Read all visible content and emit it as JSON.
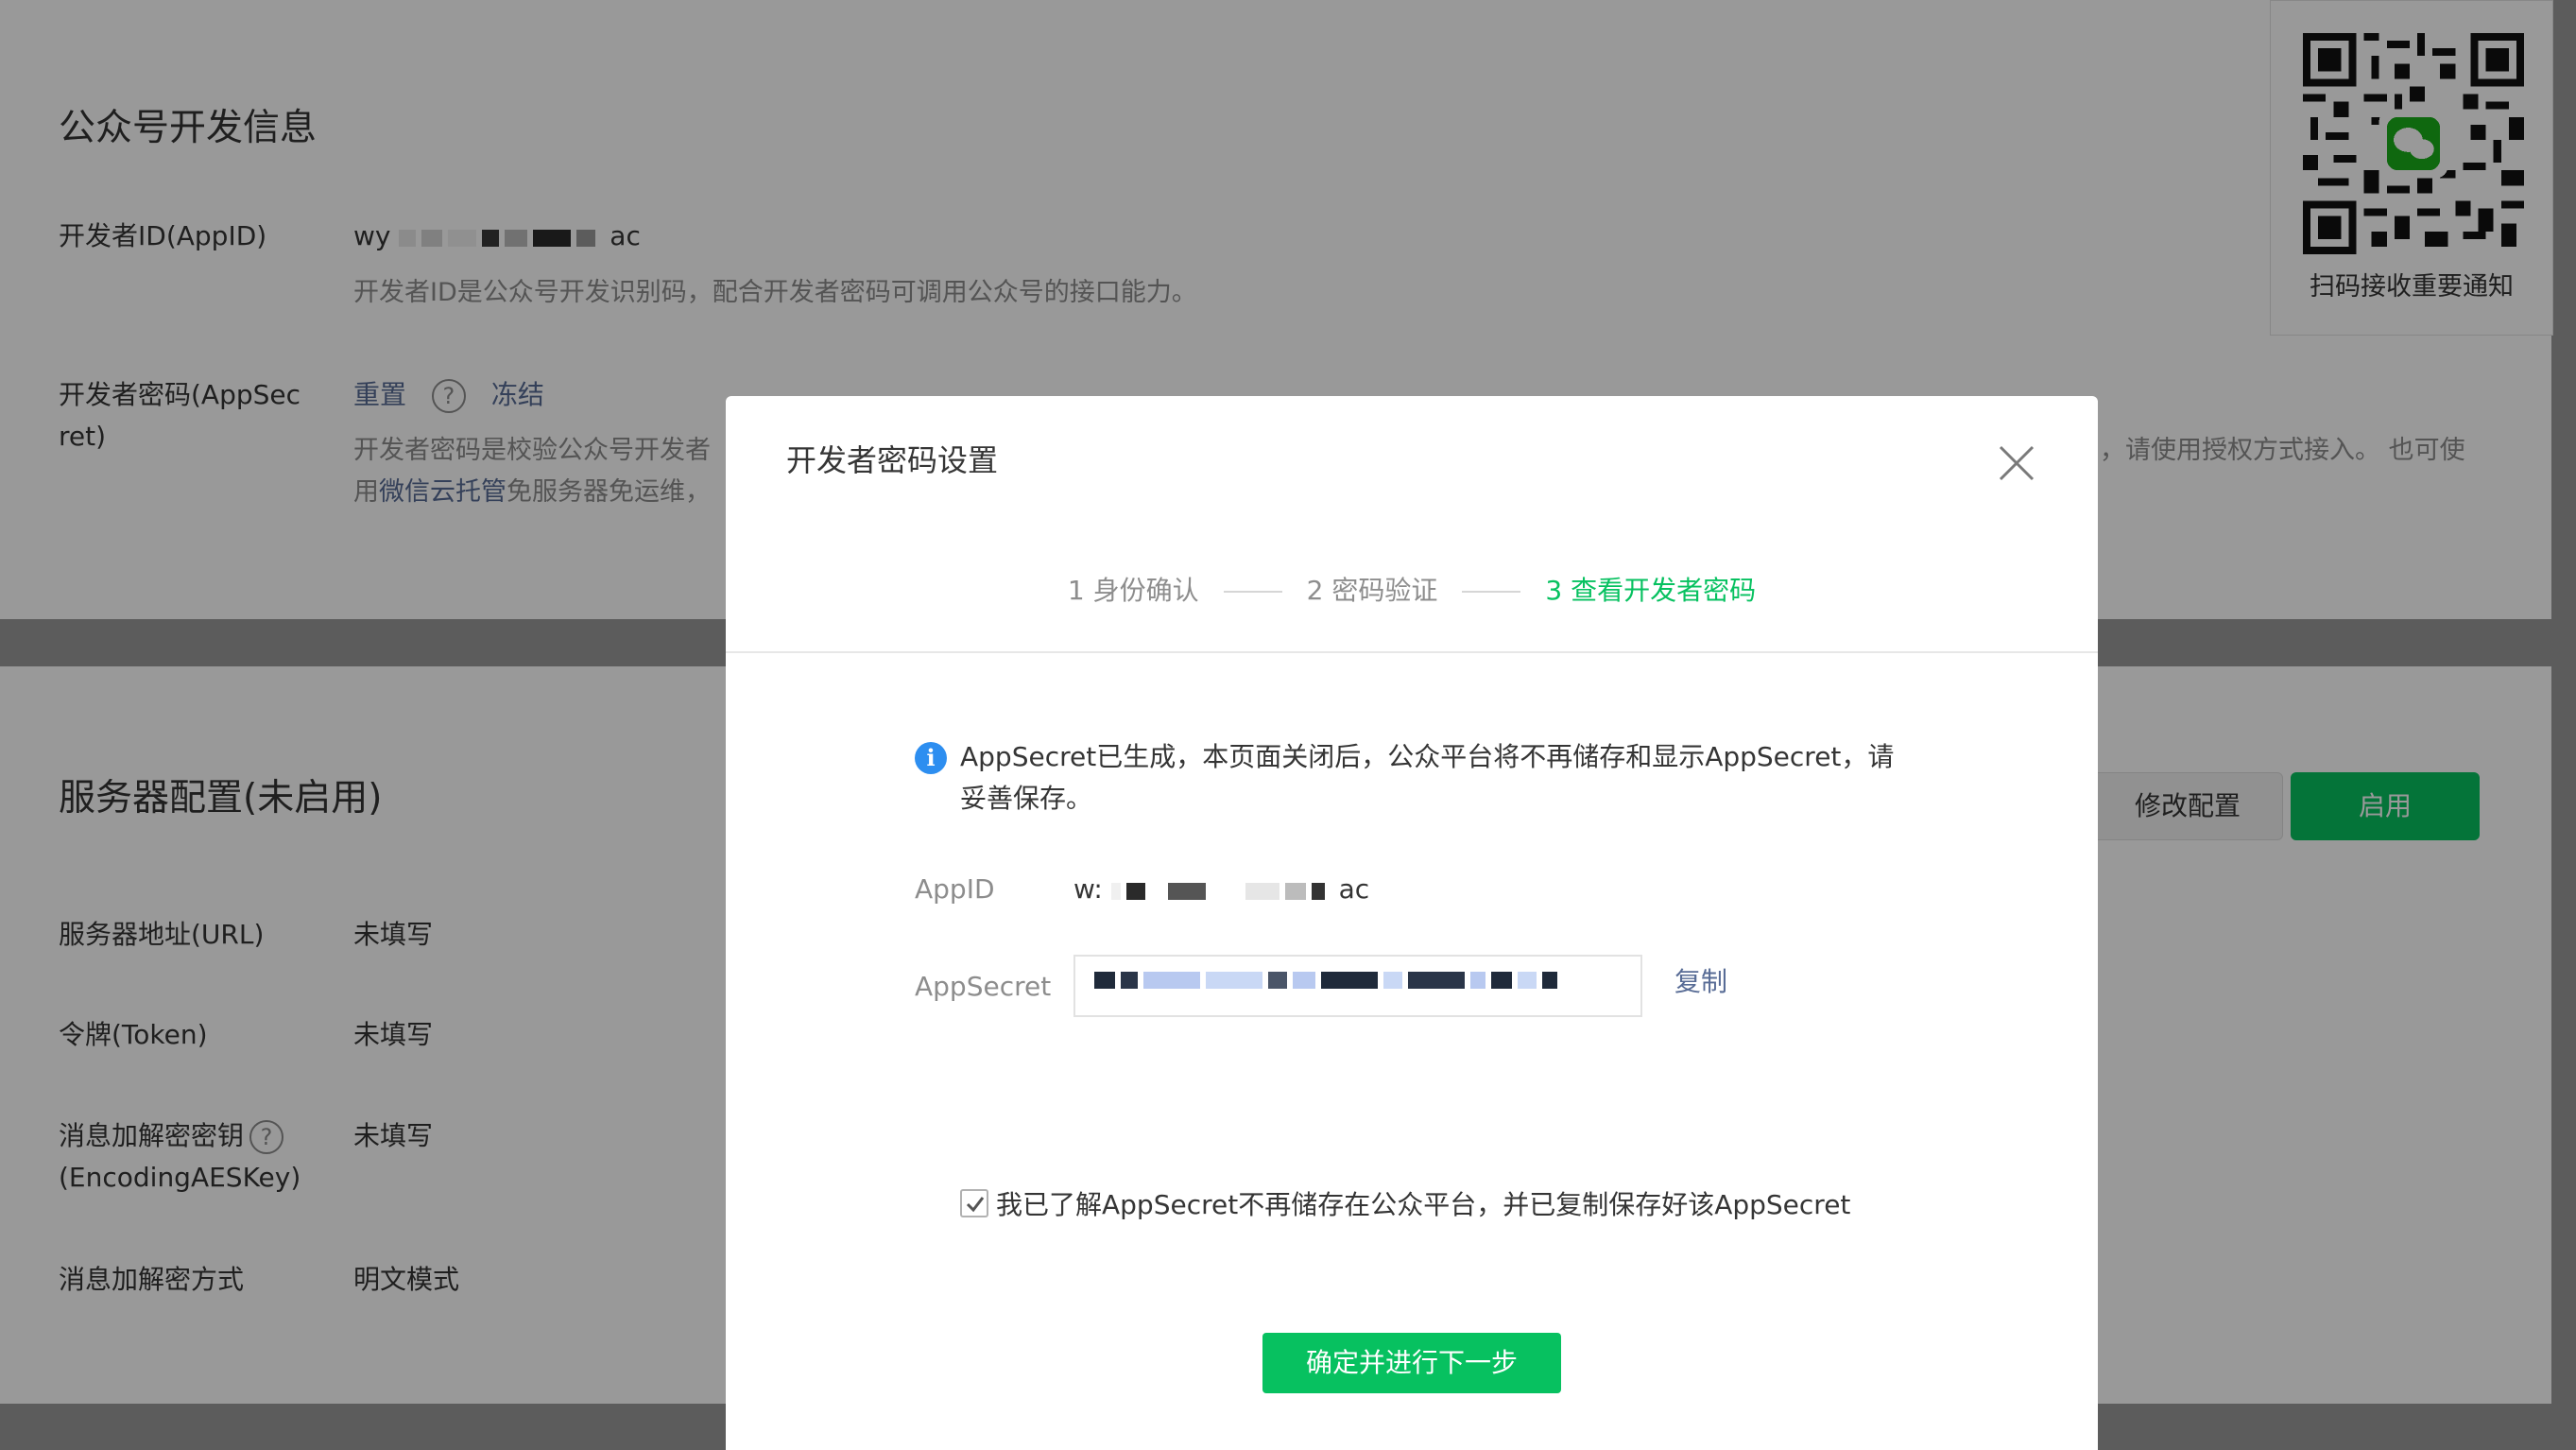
{
  "dev_info": {
    "title": "公众号开发信息",
    "appid": {
      "label": "开发者ID(AppID)",
      "value_start": "wy",
      "value_end": "ac",
      "description": "开发者ID是公众号开发识别码，配合开发者密码可调用公众号的接口能力。"
    },
    "appsecret": {
      "label_line1": "开发者密码(AppSec",
      "label_line2": "ret)",
      "reset_label": "重置",
      "help_glyph": "?",
      "freeze_label": "冻结",
      "desc_left": "开发者密码是校验公众号开发者",
      "desc_right": "，请使用授权方式接入。 也可使",
      "desc_line2_prefix": "用",
      "desc_line2_link": "微信云托管",
      "desc_line2_suffix": "免服务器免运维，"
    }
  },
  "qr_card": {
    "caption": "扫码接收重要通知"
  },
  "server_config": {
    "title": "服务器配置(未启用)",
    "modify_button": "修改配置",
    "enable_button": "启用",
    "rows": [
      {
        "label": "服务器地址(URL)",
        "value": "未填写"
      },
      {
        "label": "令牌(Token)",
        "value": "未填写"
      },
      {
        "label_line1": "消息加解密密钥",
        "label_line2": "(EncodingAESKey)",
        "value": "未填写",
        "help_glyph": "?"
      },
      {
        "label": "消息加解密方式",
        "value": "明文模式"
      }
    ]
  },
  "dialog": {
    "title": "开发者密码设置",
    "steps": [
      {
        "label": "1 身份确认",
        "active": false
      },
      {
        "label": "2 密码验证",
        "active": false
      },
      {
        "label": "3 查看开发者密码",
        "active": true
      }
    ],
    "notice": "AppSecret已生成，本页面关闭后，公众平台将不再储存和显示AppSecret，请妥善保存。",
    "info_glyph": "i",
    "appid_label": "AppID",
    "appid_value_start": "w:",
    "appid_value_end": "ac",
    "appsecret_label": "AppSecret",
    "copy_label": "复制",
    "agree_text": "我已了解AppSecret不再储存在公众平台，并已复制保存好该AppSecret",
    "agree_checked": true,
    "confirm_button": "确定并进行下一步"
  },
  "colors": {
    "primary": "#07c160",
    "link": "#576b95",
    "info": "#2d8ef0",
    "text": "#353535",
    "muted": "#8d8d8d"
  }
}
